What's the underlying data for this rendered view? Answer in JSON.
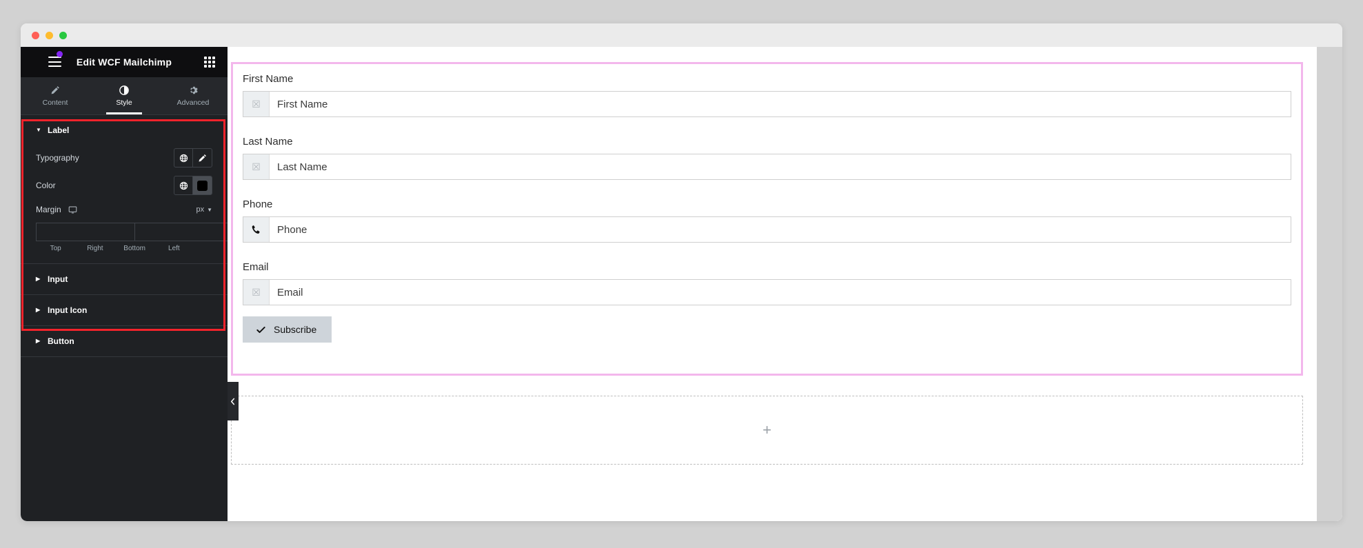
{
  "window": {
    "traffic_lights": [
      "close",
      "minimize",
      "maximize"
    ]
  },
  "panel": {
    "title": "Edit WCF Mailchimp",
    "menu_icon": "hamburger-icon",
    "notification_dot": true,
    "widgets_icon": "grid-icon",
    "tabs": [
      {
        "label": "Content",
        "icon": "pencil-icon",
        "active": false
      },
      {
        "label": "Style",
        "icon": "contrast-icon",
        "active": true
      },
      {
        "label": "Advanced",
        "icon": "gear-icon",
        "active": false
      }
    ],
    "sections": [
      {
        "id": "label",
        "label": "Label",
        "expanded": true,
        "controls": {
          "typography": {
            "label": "Typography",
            "globe_icon": "globe-icon",
            "edit_icon": "pencil-icon"
          },
          "color": {
            "label": "Color",
            "globe_icon": "globe-icon",
            "swatch_hex": "#000000"
          },
          "margin": {
            "label": "Margin",
            "device_icon": "desktop-icon",
            "unit": "px",
            "unit_chevron": "chevron-down-icon",
            "values": [
              "",
              "",
              "",
              ""
            ],
            "sides": [
              "Top",
              "Right",
              "Bottom",
              "Left"
            ],
            "link_icon": "link-icon"
          }
        }
      },
      {
        "id": "input",
        "label": "Input",
        "expanded": false
      },
      {
        "id": "input-icon",
        "label": "Input Icon",
        "expanded": false
      },
      {
        "id": "button",
        "label": "Button",
        "expanded": false
      }
    ],
    "annotation_color": "#f5232b"
  },
  "canvas": {
    "selection_color": "#f3b7ec",
    "collapse_handle_icon": "chevron-left-icon",
    "form": {
      "fields": [
        {
          "label": "First Name",
          "placeholder": "First Name",
          "icon": "missing-glyph-icon"
        },
        {
          "label": "Last Name",
          "placeholder": "Last Name",
          "icon": "missing-glyph-icon"
        },
        {
          "label": "Phone",
          "placeholder": "Phone",
          "icon": "phone-icon"
        },
        {
          "label": "Email",
          "placeholder": "Email",
          "icon": "missing-glyph-icon"
        }
      ],
      "submit": {
        "label": "Subscribe",
        "icon": "check-icon"
      }
    },
    "add_section": {
      "icon": "plus-icon"
    }
  }
}
